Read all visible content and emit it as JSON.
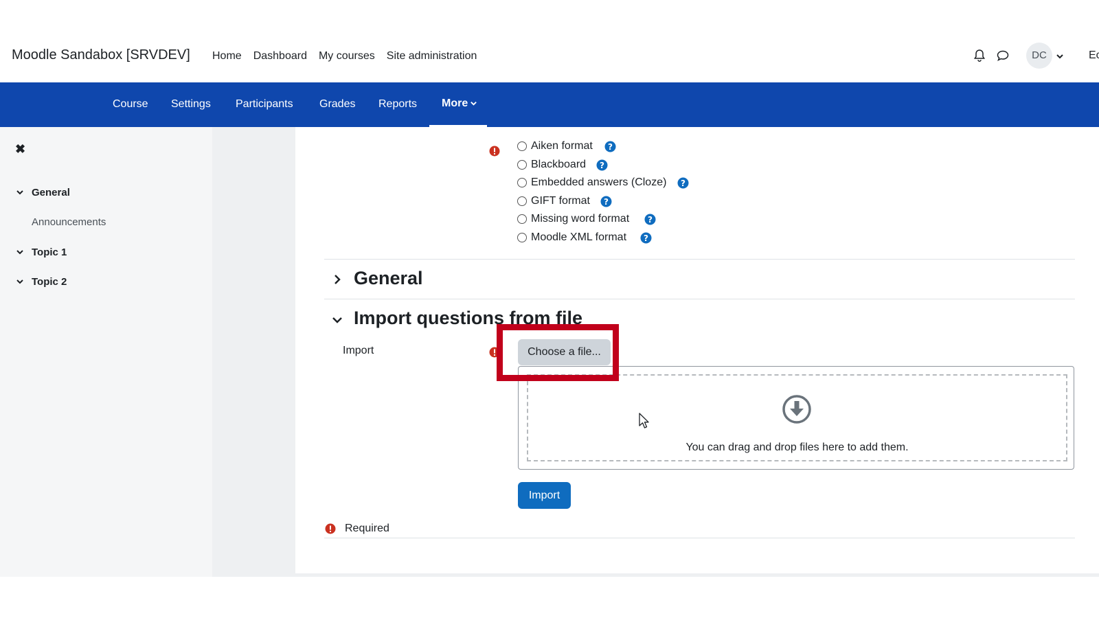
{
  "site": {
    "name": "Moodle Sandabox [SRVDEV]"
  },
  "primary_nav": [
    "Home",
    "Dashboard",
    "My courses",
    "Site administration"
  ],
  "user": {
    "initials": "DC",
    "edit_partial": "Ec"
  },
  "secondary_nav": {
    "items": [
      "Course",
      "Settings",
      "Participants",
      "Grades",
      "Reports"
    ],
    "more": "More"
  },
  "drawer": {
    "sections": [
      {
        "label": "General",
        "items": [
          "Announcements"
        ]
      },
      {
        "label": "Topic 1"
      },
      {
        "label": "Topic 2"
      }
    ]
  },
  "formats": [
    "Aiken format",
    "Blackboard",
    "Embedded answers (Cloze)",
    "GIFT format",
    "Missing word format",
    "Moodle XML format"
  ],
  "sections": {
    "general": "General",
    "import_file": "Import questions from file"
  },
  "import": {
    "label": "Import",
    "choose_button": "Choose a file...",
    "drop_text": "You can drag and drop files here to add them.",
    "submit": "Import",
    "required": "Required"
  },
  "colors": {
    "brand": "#0f47ad",
    "button_primary": "#0f6cbf",
    "required": "#ca3120",
    "help": "#0f6cbf",
    "highlight": "#c1001b"
  }
}
